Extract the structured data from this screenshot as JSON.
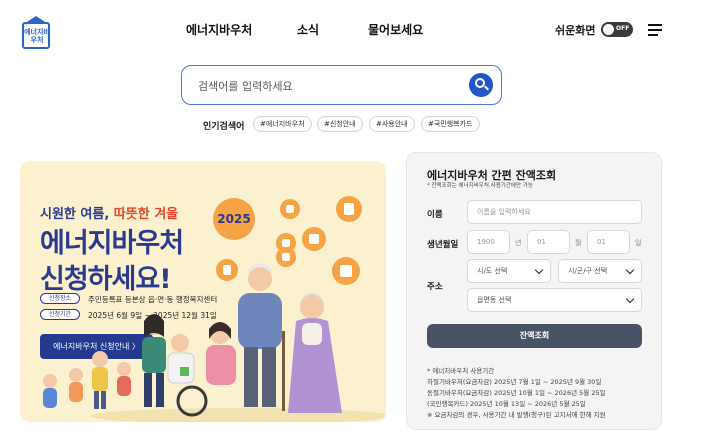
{
  "header": {
    "logo_text": "에너지바우처",
    "nav": [
      "에너지바우처",
      "소식",
      "물어보세요"
    ],
    "easy_view_label": "쉬운화면",
    "toggle_state": "OFF",
    "menu_icon": "hamburger-menu-icon"
  },
  "search": {
    "placeholder": "검색어를 입력하세요",
    "icon": "search-icon",
    "popular_label": "인기검색어",
    "tags": [
      "#에너지바우처",
      "#신청안내",
      "#사용안내",
      "#국민행복카드"
    ]
  },
  "banner": {
    "subtitle_blue": "시원한 여름, ",
    "subtitle_red": "따뜻한 겨울",
    "title_line1": "에너지바우처",
    "title_line2": "신청하세요!",
    "badge": "2025",
    "place_label": "신청장소",
    "place_value": "주민등록표 등본상 읍·면·동 행정복지센터",
    "period_label": "신청기간",
    "period_value": "2025년 6월 9일 ~ 2025년 12월 31일",
    "button": "에너지바우처 신청안내 〉"
  },
  "balance": {
    "title": "에너지바우처 간편 잔액조회",
    "note": "* 잔액조회는 에너지바우처 사용기간에만 가능",
    "name_label": "이름",
    "name_placeholder": "이름을 입력하세요",
    "birth_label": "생년월일",
    "year_value": "1900",
    "year_unit": "년",
    "month_value": "01",
    "month_unit": "월",
    "day_value": "01",
    "day_unit": "일",
    "address_label": "주소",
    "sido_placeholder": "시/도 선택",
    "sigungu_placeholder": "시/군/구 선택",
    "eupmyeon_placeholder": "읍면동 선택",
    "submit": "잔액조회",
    "info_lines": [
      "* 에너지바우처 사용기간",
      "하절기바우처(요금차감) 2025년 7월 1일 ~ 2025년 9월 30일",
      "동절기바우처(요금차감) 2025년 10월 1일 ~ 2026년 5월 25일",
      "(국민행복카드) 2025년 10월 13일 ~ 2026년 5월 25일",
      "※ 요금차감의 경우, 사용기간 내 발행(청구)된 고지서에 한해 지원"
    ]
  },
  "colors": {
    "brand_blue": "#1f56c9",
    "banner_bg": "#fbf1cf",
    "banner_navy": "#2a3b8f",
    "accent_red": "#e4462d",
    "accent_orange": "#f5a344",
    "submit_gray": "#4a5265"
  }
}
